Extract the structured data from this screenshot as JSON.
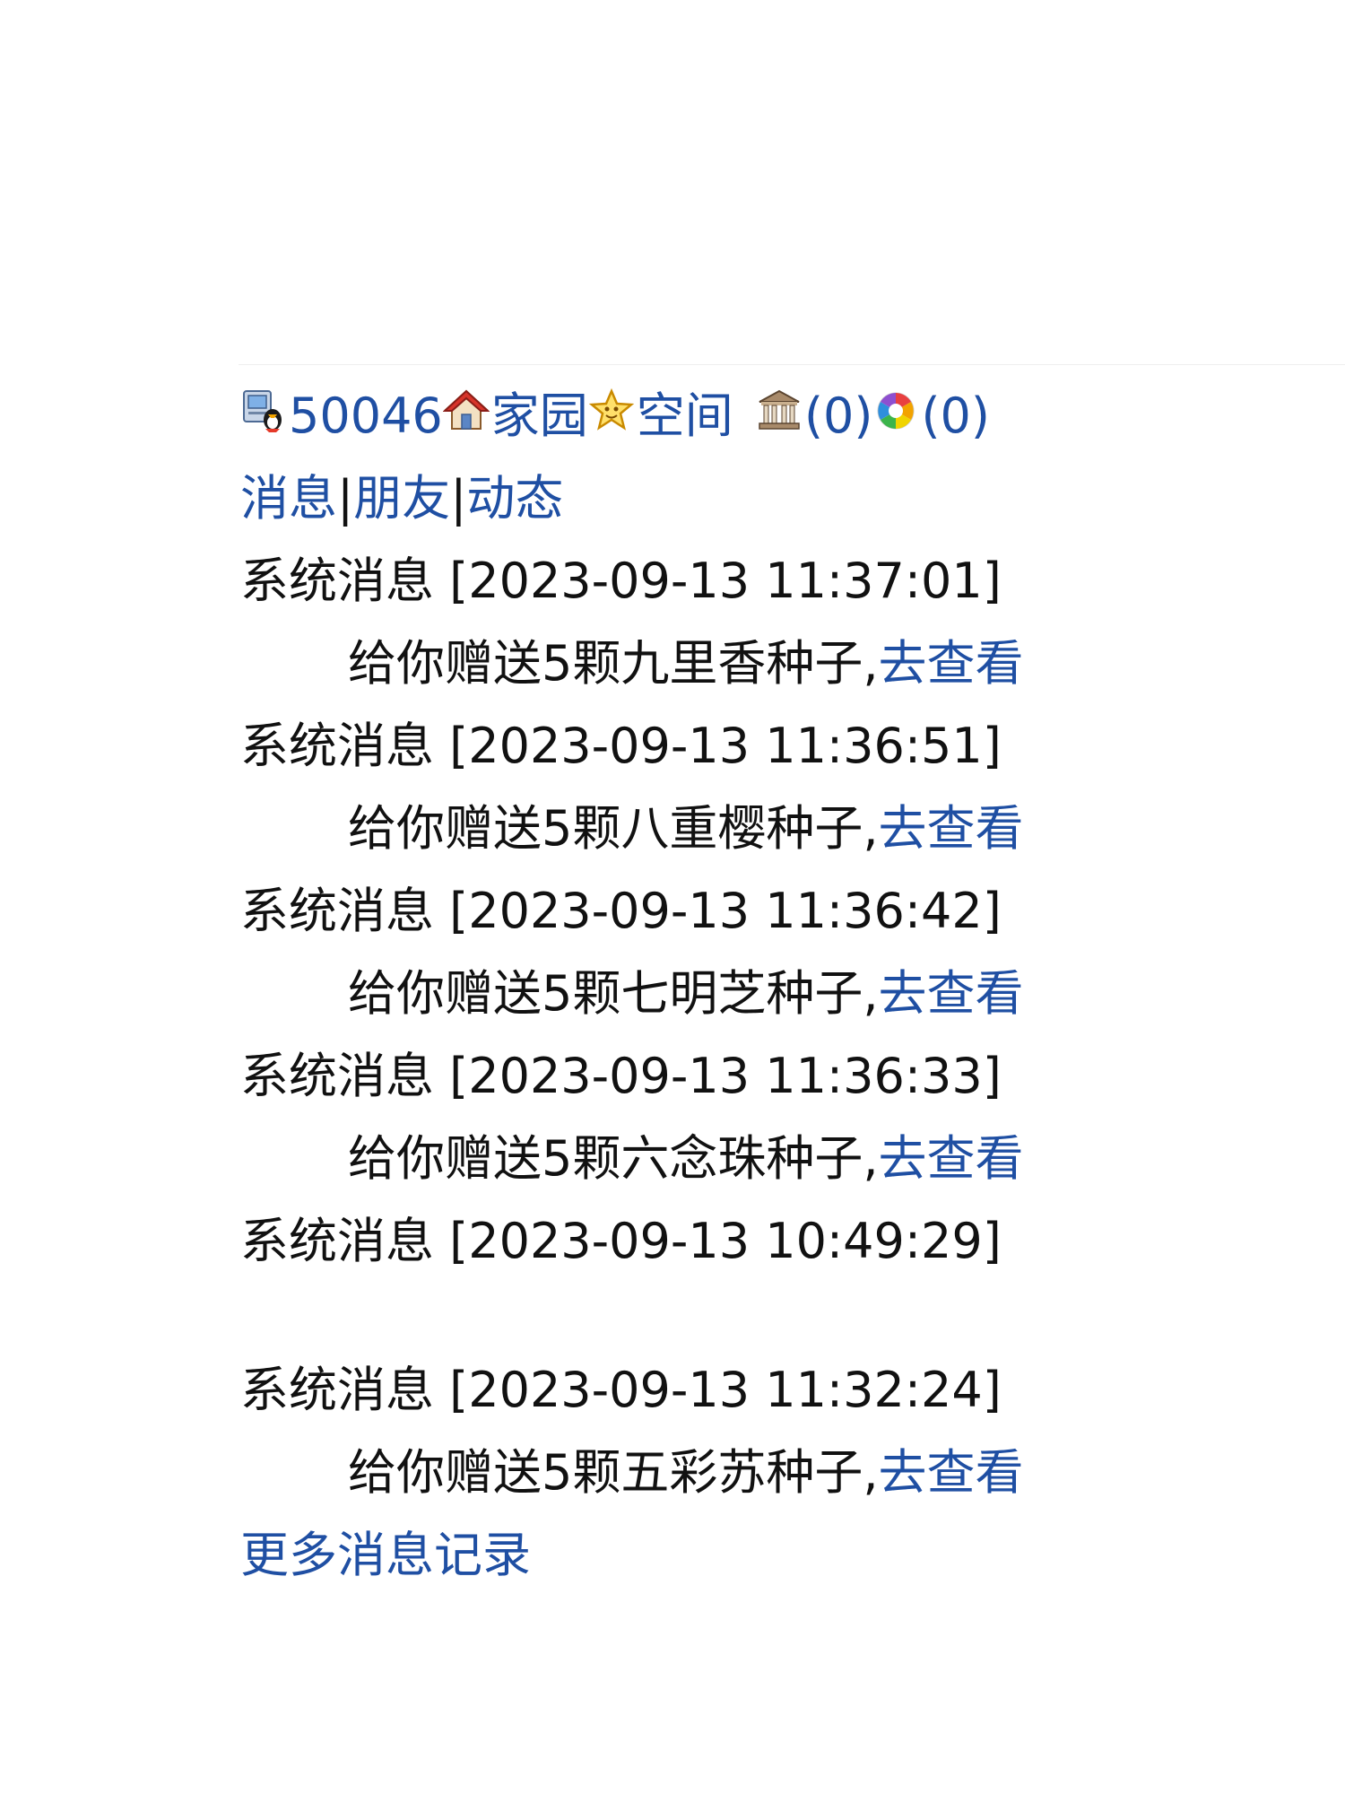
{
  "header": {
    "user_id": "50046",
    "home_label": "家园",
    "space_label": "空间",
    "bank_count": "(0)",
    "photo_count": "(0)"
  },
  "nav": {
    "messages": "消息",
    "separator": "|",
    "friends": "朋友",
    "activity": "动态"
  },
  "messages": [
    {
      "title": "系统消息 [2023-09-13 11:37:01]",
      "body": "给你赠送5颗九里香种子,",
      "link": "去查看"
    },
    {
      "title": "系统消息 [2023-09-13 11:36:51]",
      "body": "给你赠送5颗八重樱种子,",
      "link": "去查看"
    },
    {
      "title": "系统消息 [2023-09-13 11:36:42]",
      "body": "给你赠送5颗七明芝种子,",
      "link": "去查看"
    },
    {
      "title": "系统消息 [2023-09-13 11:36:33]",
      "body": "给你赠送5颗六念珠种子,",
      "link": "去查看"
    },
    {
      "title": "系统消息 [2023-09-13 10:49:29]"
    },
    {
      "title": "系统消息 [2023-09-13 11:32:24]",
      "body": "给你赠送5颗五彩苏种子,",
      "link": "去查看"
    }
  ],
  "more_link": "更多消息记录",
  "icons": {
    "user": "user-computer-icon",
    "home": "house-icon",
    "space": "star-icon",
    "bank": "bank-building-icon",
    "photo": "camera-aperture-icon"
  },
  "colors": {
    "link": "#1f4fa3",
    "text": "#111111",
    "background": "#ffffff"
  }
}
